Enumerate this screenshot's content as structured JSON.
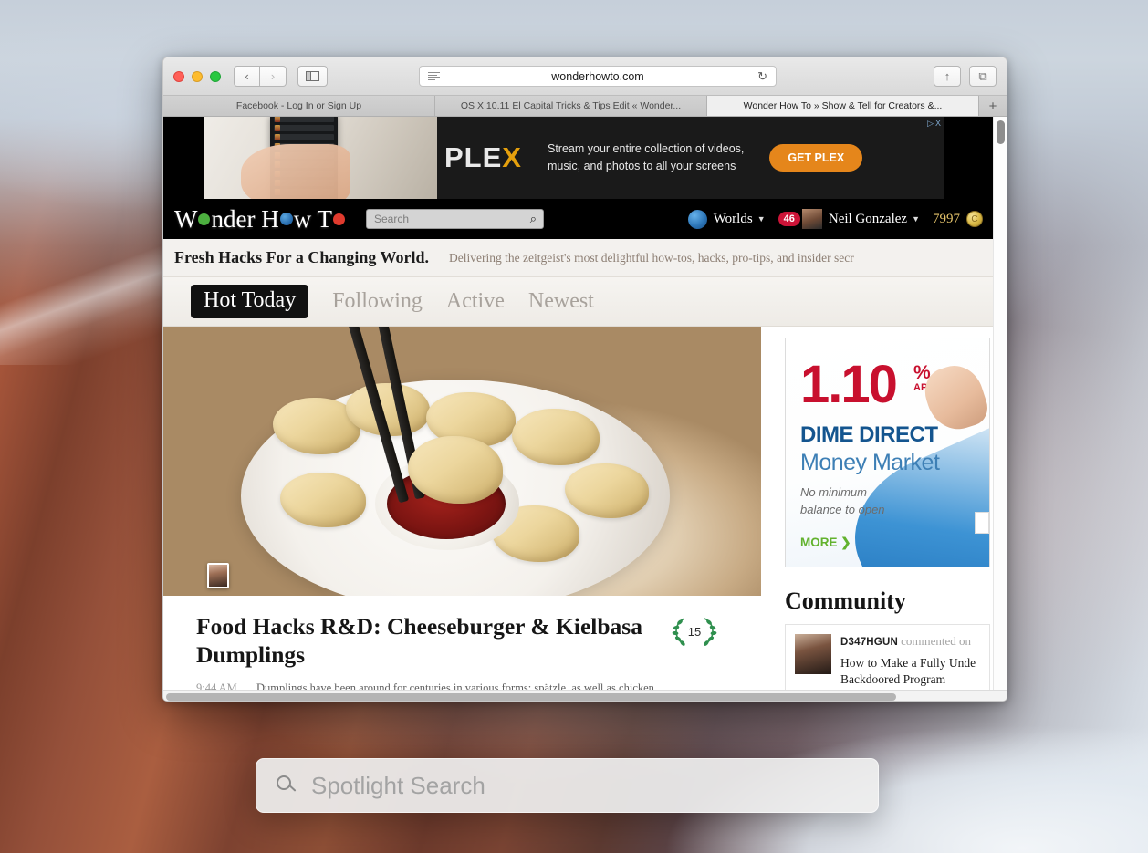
{
  "browser": {
    "window_controls": {
      "close": "close",
      "minimize": "minimize",
      "zoom": "zoom"
    },
    "back_label": "‹",
    "forward_label": "›",
    "sidebar_label": "▯",
    "reader_label": "reader",
    "url": "wonderhowto.com",
    "reload_label": "↻",
    "share_label": "↑",
    "tabs_overview_label": "⧉",
    "tabs": [
      {
        "title": "Facebook - Log In or Sign Up",
        "active": false
      },
      {
        "title": "OS X 10.11 El Capital Tricks & Tips Edit « Wonder...",
        "active": false
      },
      {
        "title": "Wonder How To » Show & Tell for Creators &...",
        "active": true
      }
    ],
    "new_tab_label": "+"
  },
  "ad_banner": {
    "brand": "PLE",
    "brand_accent": "X",
    "copy_line1": "Stream your entire collection of videos,",
    "copy_line2": "music, and photos to all your screens",
    "cta": "GET PLEX",
    "adchoices": "▷",
    "close": "X"
  },
  "site_header": {
    "logo_part1": "W",
    "logo_part2": "nder H",
    "logo_part3": "w T",
    "search_placeholder": "Search",
    "search_icon": "⌕",
    "worlds_label": "Worlds",
    "worlds_caret": "▼",
    "notification_count": "46",
    "username": "Neil Gonzalez",
    "user_caret": "▼",
    "points": "7997",
    "coin_label": "C"
  },
  "tagline": {
    "headline": "Fresh Hacks For a Changing World.",
    "sub": "Delivering the zeitgeist's most delightful how-tos, hacks, pro-tips, and insider secr"
  },
  "nav_tabs": [
    {
      "label": "Hot Today",
      "active": true
    },
    {
      "label": "Following",
      "active": false
    },
    {
      "label": "Active",
      "active": false
    },
    {
      "label": "Newest",
      "active": false
    }
  ],
  "feature_article": {
    "play_label": "▶",
    "title": "Food Hacks R&D: Cheeseburger & Kielbasa Dumplings",
    "score": "15",
    "time": "9:44 AM",
    "dek": "Dumplings have been around for centuries in various forms: spätzle, as well as chicken"
  },
  "sidebar_ad": {
    "rate": "1.10",
    "percent": "%",
    "apy": "APY*",
    "brand_line1": "DIME DIRECT",
    "brand_line2": "Money Market",
    "sub_line1": "No minimum",
    "sub_line2": "balance to open",
    "more": "MORE ❯"
  },
  "community": {
    "heading": "Community",
    "items": [
      {
        "user": "D347HGUN",
        "action": "commented on",
        "title_line1": "How to Make a Fully Unde",
        "title_line2": "Backdoored Program"
      }
    ]
  },
  "spotlight": {
    "placeholder": "Spotlight Search",
    "icon": "search-icon"
  },
  "colors": {
    "accent_red": "#c8102e",
    "ad_orange": "#e5861b",
    "brand_blue": "#14558f",
    "more_green": "#62b22e",
    "badge_red": "#cc1438"
  }
}
